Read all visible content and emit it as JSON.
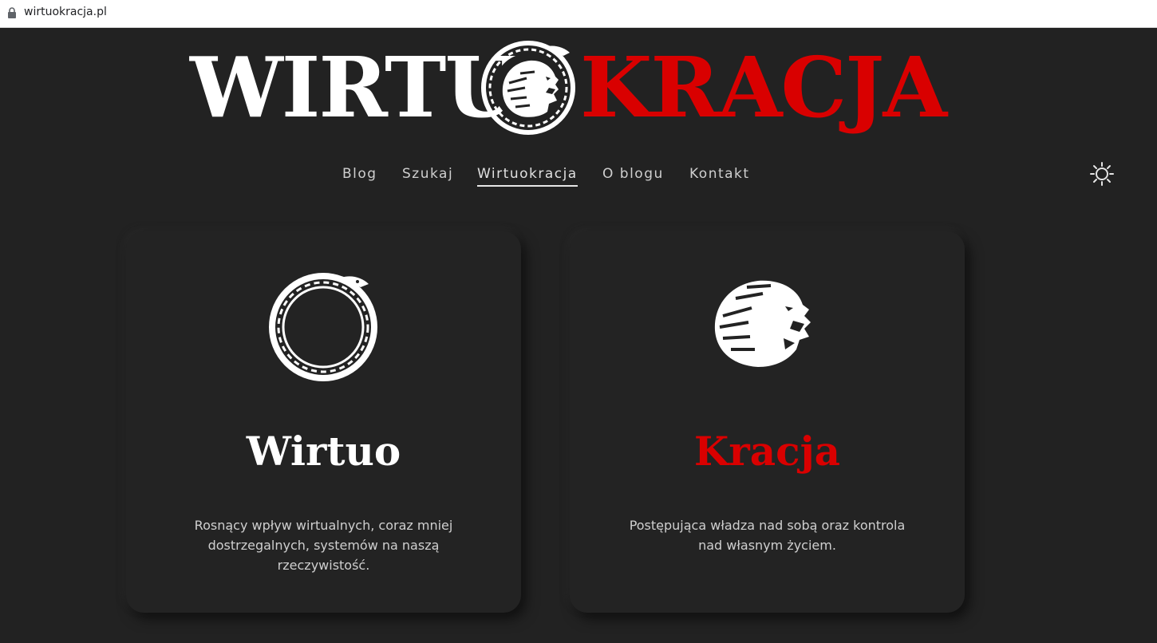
{
  "browser": {
    "url": "wirtuokracja.pl"
  },
  "logo": {
    "left": "WIRTU",
    "right": "KRACJA"
  },
  "nav": {
    "items": [
      {
        "label": "Blog"
      },
      {
        "label": "Szukaj"
      },
      {
        "label": "Wirtuokracja",
        "active": true
      },
      {
        "label": "O blogu"
      },
      {
        "label": "Kontakt"
      }
    ],
    "theme_icon": "sun-icon"
  },
  "cards": [
    {
      "icon": "ouroboros-icon",
      "title": "Wirtuo",
      "text": "Rosnący wpływ wirtualnych, coraz mniej dostrzegalnych, systemów na naszą rzeczywistość.",
      "title_color": "#ffffff"
    },
    {
      "icon": "lion-head-icon",
      "title": "Kracja",
      "text": "Postępująca władza nad sobą oraz kontrola nad własnym życiem.",
      "title_color": "#d90000"
    }
  ],
  "colors": {
    "background": "#222222",
    "accent": "#d90000",
    "text": "#cfcfcf"
  }
}
